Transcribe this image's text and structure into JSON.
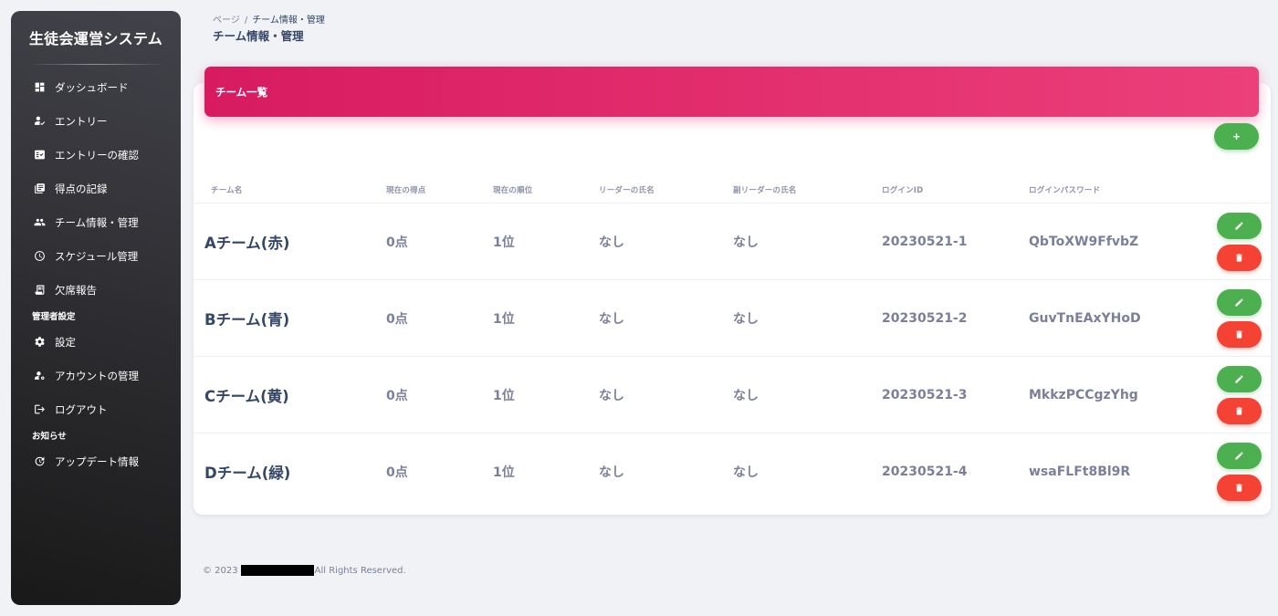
{
  "sidebar": {
    "brand": "生徒会運営システム",
    "items": [
      {
        "label": "ダッシュボード",
        "icon": "dashboard-icon"
      },
      {
        "label": "エントリー",
        "icon": "person-check-icon"
      },
      {
        "label": "エントリーの確認",
        "icon": "fact-check-icon"
      },
      {
        "label": "得点の記録",
        "icon": "library-books-icon"
      },
      {
        "label": "チーム情報・管理",
        "icon": "group-icon"
      },
      {
        "label": "スケジュール管理",
        "icon": "schedule-icon"
      },
      {
        "label": "欠席報告",
        "icon": "receipt-long-icon"
      }
    ],
    "section_admin": "管理者設定",
    "admin_items": [
      {
        "label": "設定",
        "icon": "settings-icon"
      },
      {
        "label": "アカウントの管理",
        "icon": "manage-accounts-icon"
      },
      {
        "label": "ログアウト",
        "icon": "logout-icon"
      }
    ],
    "section_news": "お知らせ",
    "news_items": [
      {
        "label": "アップデート情報",
        "icon": "update-icon"
      }
    ]
  },
  "header": {
    "breadcrumb_root": "ページ",
    "breadcrumb_sep": "/",
    "breadcrumb_current": "チーム情報・管理",
    "title": "チーム情報・管理"
  },
  "card": {
    "title": "チーム一覧",
    "add_label": "+"
  },
  "table": {
    "columns": [
      "チーム名",
      "現在の得点",
      "現在の順位",
      "リーダーの氏名",
      "副リーダーの氏名",
      "ログインID",
      "ログインパスワード"
    ],
    "rows": [
      {
        "name": "Aチーム(赤)",
        "score": "0点",
        "rank": "1位",
        "leader": "なし",
        "sub_leader": "なし",
        "login_id": "20230521-1",
        "password": "QbToXW9FfvbZ"
      },
      {
        "name": "Bチーム(青)",
        "score": "0点",
        "rank": "1位",
        "leader": "なし",
        "sub_leader": "なし",
        "login_id": "20230521-2",
        "password": "GuvTnEAxYHoD"
      },
      {
        "name": "Cチーム(黄)",
        "score": "0点",
        "rank": "1位",
        "leader": "なし",
        "sub_leader": "なし",
        "login_id": "20230521-3",
        "password": "MkkzPCCgzYhg"
      },
      {
        "name": "Dチーム(緑)",
        "score": "0点",
        "rank": "1位",
        "leader": "なし",
        "sub_leader": "なし",
        "login_id": "20230521-4",
        "password": "wsaFLFt8Bl9R"
      }
    ]
  },
  "footer": {
    "copyright": "© 2023",
    "rights": "All Rights Reserved."
  },
  "colors": {
    "header_gradient_start": "#d81b60",
    "header_gradient_end": "#ec407a",
    "add_edit_green": "#4caf50",
    "delete_red": "#f44335"
  }
}
